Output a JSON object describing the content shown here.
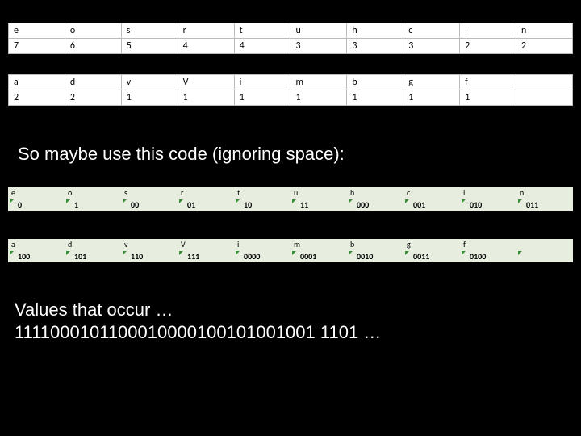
{
  "freq1": {
    "chars": [
      "e",
      "o",
      "s",
      "r",
      "t",
      "u",
      "h",
      "c",
      "l",
      "n"
    ],
    "counts": [
      "7",
      "6",
      "5",
      "4",
      "4",
      "3",
      "3",
      "3",
      "2",
      "2"
    ]
  },
  "freq2": {
    "chars": [
      "a",
      "d",
      "v",
      "V",
      "i",
      "m",
      "b",
      "g",
      "f"
    ],
    "counts": [
      "2",
      "2",
      "1",
      "1",
      "1",
      "1",
      "1",
      "1",
      "1"
    ]
  },
  "code1": {
    "chars": [
      "e",
      "o",
      "s",
      "r",
      "t",
      "u",
      "h",
      "c",
      "l",
      "n"
    ],
    "codes": [
      "0",
      "1",
      "00",
      "01",
      "10",
      "11",
      "000",
      "001",
      "010",
      "011"
    ]
  },
  "code2": {
    "chars": [
      "a",
      "d",
      "v",
      "V",
      "i",
      "m",
      "b",
      "g",
      "f"
    ],
    "codes": [
      "100",
      "101",
      "110",
      "111",
      "0000",
      "0001",
      "0010",
      "0011",
      "0100"
    ]
  },
  "caption1": "So maybe use this code (ignoring space):",
  "caption2_line1": "Values that  occur  …",
  "caption2_line2": "1111000101100010000100101001001 1101  …"
}
